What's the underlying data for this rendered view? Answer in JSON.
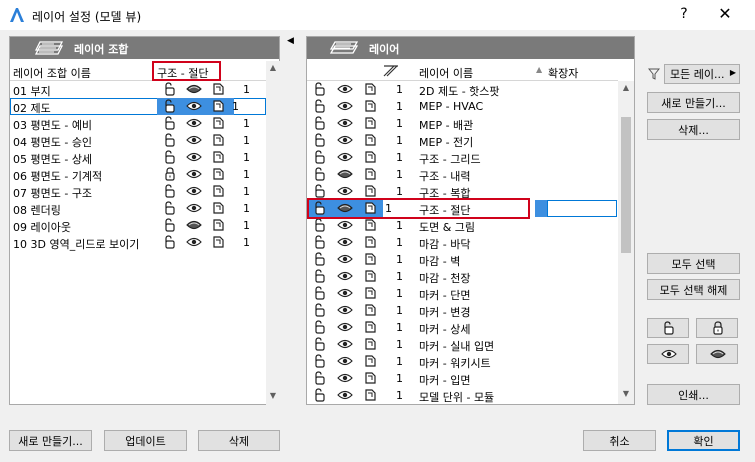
{
  "window": {
    "title": "레이어 설정 (모델 뷰)",
    "help": "?",
    "close": "✕"
  },
  "combos_panel": {
    "header": "레이어 조합",
    "col_name": "레이어 조합 이름",
    "current_layer": "구조 - 절단",
    "items": [
      {
        "name": "01 부지",
        "lock": "open",
        "vis": "solid",
        "val": "1"
      },
      {
        "name": "02 제도",
        "lock": "open",
        "vis": "eye",
        "val": "1",
        "selected": true
      },
      {
        "name": "03 평면도 - 예비",
        "lock": "open",
        "vis": "eye",
        "val": "1"
      },
      {
        "name": "04 평면도 - 승인",
        "lock": "open",
        "vis": "eye",
        "val": "1"
      },
      {
        "name": "05 평면도 - 상세",
        "lock": "open",
        "vis": "eye",
        "val": "1"
      },
      {
        "name": "06 평면도 - 기계적",
        "lock": "closed",
        "vis": "eye",
        "val": "1"
      },
      {
        "name": "07 평면도 - 구조",
        "lock": "open",
        "vis": "eye",
        "val": "1"
      },
      {
        "name": "08 렌더링",
        "lock": "open",
        "vis": "eye",
        "val": "1"
      },
      {
        "name": "09 레이아웃",
        "lock": "open",
        "vis": "solid",
        "val": "1"
      },
      {
        "name": "10 3D 영역_리드로 보이기",
        "lock": "open",
        "vis": "eye",
        "val": "1"
      }
    ],
    "buttons": {
      "new": "새로 만들기...",
      "update": "업데이트",
      "delete": "삭제"
    }
  },
  "layers_panel": {
    "header": "레이어",
    "col_name": "레이어 이름",
    "col_ext": "확장자",
    "items": [
      {
        "name": "2D 제도 - 핫스팟",
        "vis": "eye",
        "val": "1"
      },
      {
        "name": "MEP - HVAC",
        "vis": "eye",
        "val": "1"
      },
      {
        "name": "MEP - 배관",
        "vis": "eye",
        "val": "1"
      },
      {
        "name": "MEP - 전기",
        "vis": "eye",
        "val": "1"
      },
      {
        "name": "구조 - 그리드",
        "vis": "eye",
        "val": "1"
      },
      {
        "name": "구조 - 내력",
        "vis": "solid",
        "val": "1"
      },
      {
        "name": "구조 - 복합",
        "vis": "eye",
        "val": "1"
      },
      {
        "name": "구조 - 절단",
        "vis": "solid",
        "val": "1",
        "selected": true
      },
      {
        "name": "도면 & 그림",
        "vis": "eye",
        "val": "1"
      },
      {
        "name": "마감 - 바닥",
        "vis": "eye",
        "val": "1"
      },
      {
        "name": "마감 - 벽",
        "vis": "eye",
        "val": "1"
      },
      {
        "name": "마감 - 천장",
        "vis": "eye",
        "val": "1"
      },
      {
        "name": "마커 - 단면",
        "vis": "eye",
        "val": "1"
      },
      {
        "name": "마커 - 변경",
        "vis": "eye",
        "val": "1"
      },
      {
        "name": "마커 - 상세",
        "vis": "eye",
        "val": "1"
      },
      {
        "name": "마커 - 실내 입면",
        "vis": "eye",
        "val": "1"
      },
      {
        "name": "마커 - 워키시트",
        "vis": "eye",
        "val": "1"
      },
      {
        "name": "마커 - 입면",
        "vis": "eye",
        "val": "1"
      },
      {
        "name": "모델 단위 - 모듈",
        "vis": "eye",
        "val": "1"
      }
    ]
  },
  "side": {
    "filter_value": "모든 레이...",
    "new": "새로 만들기...",
    "delete": "삭제...",
    "select_all": "모두 선택",
    "deselect_all": "모두 선택 해제",
    "print": "인쇄..."
  },
  "footer": {
    "cancel": "취소",
    "ok": "확인"
  }
}
